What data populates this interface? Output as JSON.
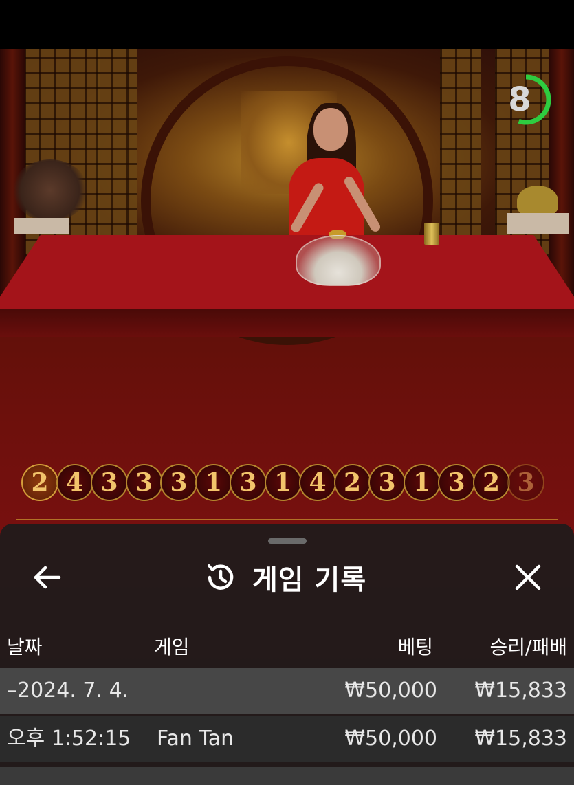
{
  "game_video": {
    "countdown": "8",
    "countdown_fraction": 0.55,
    "accent_color": "#2ecc40"
  },
  "roadmap": {
    "results": [
      "2",
      "4",
      "3",
      "3",
      "3",
      "1",
      "3",
      "1",
      "4",
      "2",
      "3",
      "1",
      "3",
      "2",
      "3"
    ]
  },
  "history_panel": {
    "title": "게임 기록",
    "back_icon": "arrow-left-icon",
    "history_icon": "history-clock-icon",
    "close_icon": "close-x-icon",
    "columns": {
      "date": "날짜",
      "game": "게임",
      "bet": "베팅",
      "win_loss": "승리/패배"
    },
    "date_group": {
      "label": "–2024. 7. 4.",
      "bet_total": "₩50,000",
      "win_loss_total": "₩15,833"
    },
    "rows": [
      {
        "time": "오후 1:52:15",
        "game": "Fan Tan",
        "bet": "₩50,000",
        "win_loss": "₩15,833"
      }
    ]
  }
}
